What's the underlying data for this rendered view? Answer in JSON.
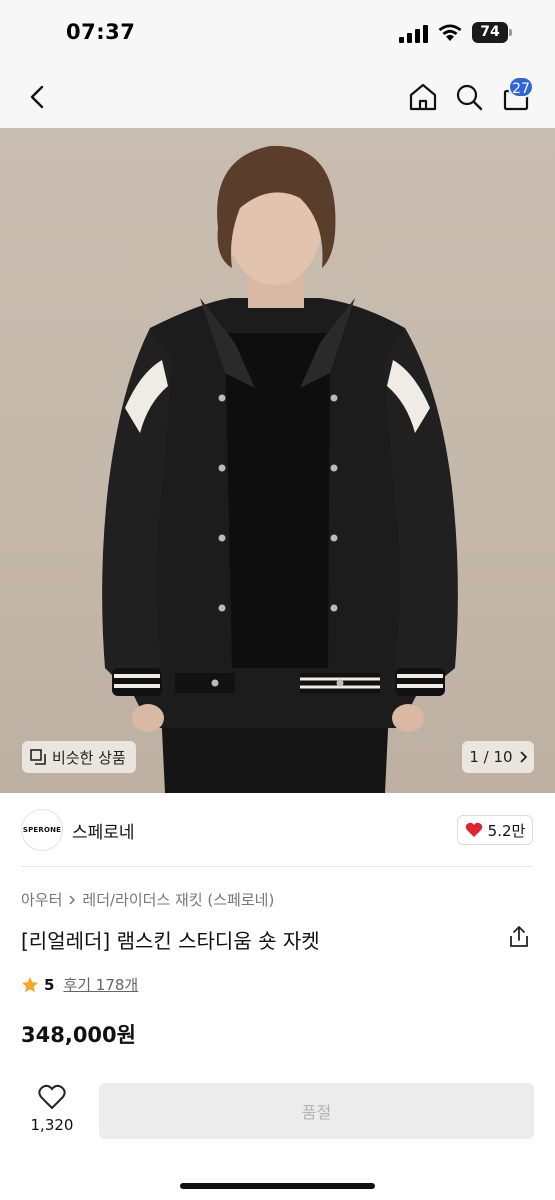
{
  "status_bar": {
    "time": "07:37",
    "battery": "74"
  },
  "nav": {
    "cart_count": "27",
    "icons": [
      "back-icon",
      "home-icon",
      "search-icon",
      "shopping-bag-icon"
    ]
  },
  "image": {
    "similar_label": "비슷한 상품",
    "counter": "1 / 10"
  },
  "brand": {
    "logo_text": "SPERONE",
    "name": "스페로네",
    "likes": "5.2만"
  },
  "breadcrumb": {
    "category": "아우터",
    "subcategory": "레더/라이더스 재킷 (스페로네)"
  },
  "product": {
    "title": "[리얼레더] 램스킨 스타디움 숏 자켓",
    "rating": "5",
    "reviews": "후기 178개",
    "price": "348,000원"
  },
  "bottom": {
    "wish_count": "1,320",
    "soldout_label": "품절"
  },
  "colors": {
    "badge": "#2f66d9",
    "heart": "#e0242f",
    "star": "#f5a623"
  }
}
